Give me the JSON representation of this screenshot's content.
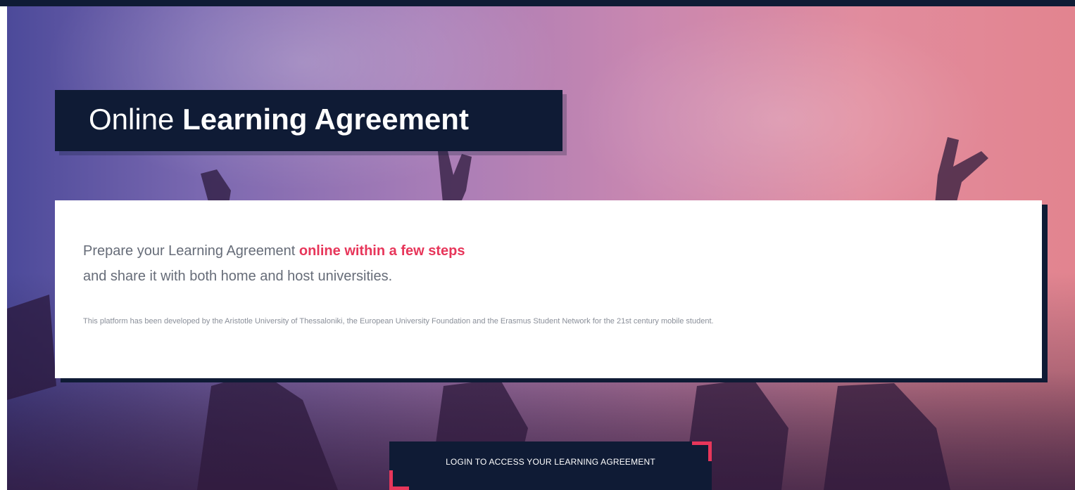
{
  "colors": {
    "navy": "#0f1b35",
    "accent": "#e7365a",
    "body_text": "#666c78",
    "small_text": "#8a8f99"
  },
  "header": {
    "title_light": "Online",
    "title_bold": "Learning Agreement"
  },
  "intro": {
    "line1_prefix": "Prepare your Learning Agreement",
    "line1_highlight": "online within a few steps",
    "line2": "and share it with both home and host universities."
  },
  "about": {
    "text": "This platform has been developed by the Aristotle University of Thessaloniki, the European University Foundation and the Erasmus Student Network for the 21st century mobile student."
  },
  "login": {
    "label": "LOGIN TO ACCESS YOUR LEARNING AGREEMENT"
  }
}
